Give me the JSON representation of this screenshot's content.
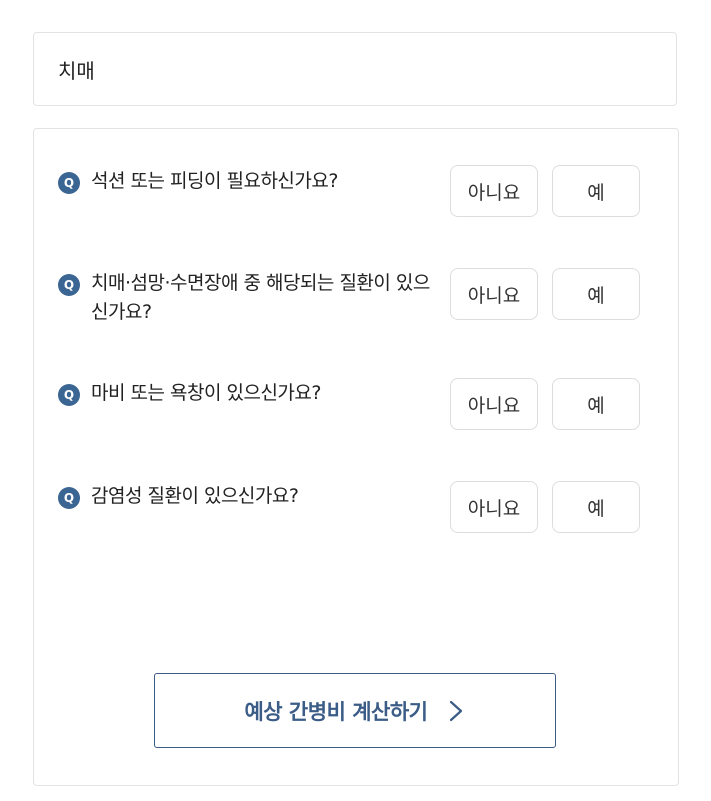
{
  "selected": {
    "label": "치매"
  },
  "badge_label": "Q",
  "questions": [
    {
      "text": "석션 또는 피딩이 필요하신가요?",
      "no_label": "아니요",
      "yes_label": "예"
    },
    {
      "text": "치매·섬망·수면장애 중 해당되는 질환이 있으신가요?",
      "no_label": "아니요",
      "yes_label": "예"
    },
    {
      "text": "마비 또는 욕창이 있으신가요?",
      "no_label": "아니요",
      "yes_label": "예"
    },
    {
      "text": "감염성 질환이 있으신가요?",
      "no_label": "아니요",
      "yes_label": "예"
    }
  ],
  "calculate": {
    "label": "예상 간병비 계산하기",
    "icon": "chevron-right-icon"
  },
  "colors": {
    "accent": "#3b5c86",
    "badge": "#3b6592",
    "border": "#e3e3e3"
  }
}
